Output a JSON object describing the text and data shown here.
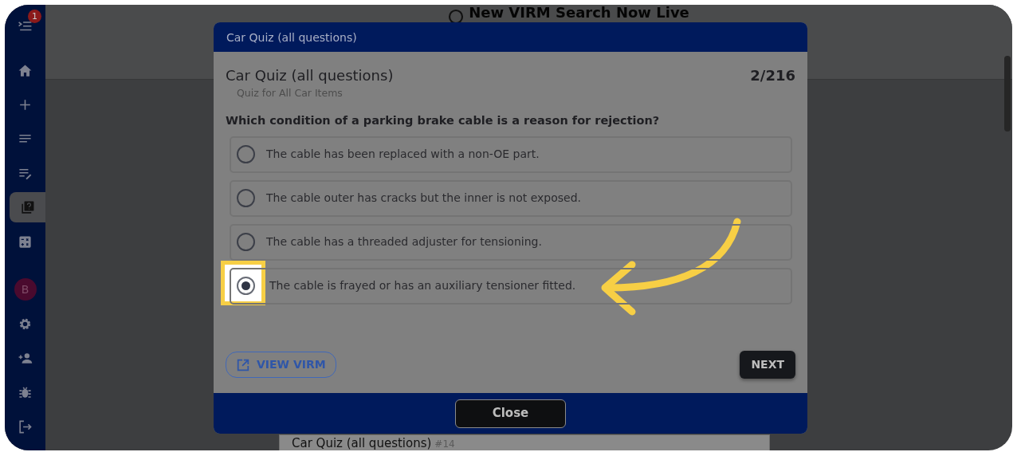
{
  "sidebar": {
    "badge": "1",
    "avatar": "B",
    "items": [
      {
        "kind": "home",
        "selected": false
      },
      {
        "kind": "plus",
        "selected": false
      },
      {
        "kind": "list",
        "selected": false
      },
      {
        "kind": "edit-list",
        "selected": false
      },
      {
        "kind": "quiz",
        "selected": true
      },
      {
        "kind": "calculator",
        "selected": false
      }
    ],
    "bottom_items": [
      {
        "kind": "gear"
      },
      {
        "kind": "person-add"
      },
      {
        "kind": "bug"
      },
      {
        "kind": "logout"
      }
    ]
  },
  "banner": {
    "title": "New VIRM Search Now Live"
  },
  "background_card": {
    "title": "Car Quiz (all questions)",
    "number": "#14"
  },
  "modal": {
    "header": "Car Quiz (all questions)",
    "title": "Car Quiz (all questions)",
    "counter": "2/216",
    "subtitle": "Quiz for All Car Items",
    "question": "Which condition of a parking brake cable is a reason for rejection?",
    "options": [
      {
        "text": "The cable has been replaced with a non-OE part.",
        "selected": false
      },
      {
        "text": "The cable outer has cracks but the inner is not exposed.",
        "selected": false
      },
      {
        "text": "The cable has a threaded adjuster for tensioning.",
        "selected": false
      },
      {
        "text": "The cable is frayed or has an auxiliary tensioner fitted.",
        "selected": true
      }
    ],
    "view_button": "VIEW VIRM",
    "next_button": "NEXT",
    "close_button": "Close"
  }
}
